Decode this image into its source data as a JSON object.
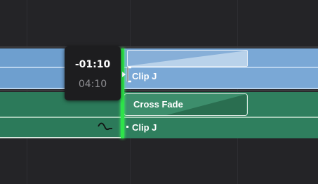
{
  "timeline": {
    "background_color": "#242427",
    "video_track": {
      "color": "#6e9fcf",
      "clip_label": "Clip J"
    },
    "audio_track": {
      "color": "#2f7f5e",
      "transition_label": "Cross Fade",
      "clip_label": "Clip J"
    },
    "edit_point": {
      "color": "#2ee34a"
    },
    "tooltip": {
      "offset": "-01:10",
      "duration": "04:10"
    },
    "icons": {
      "trim_cursor": "trim-cursor-icon",
      "fade_curve": "fade-curve-icon"
    }
  }
}
